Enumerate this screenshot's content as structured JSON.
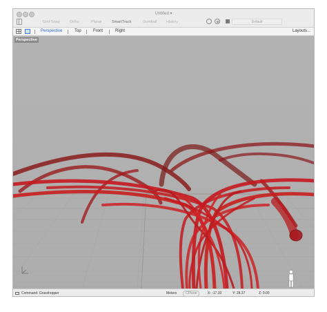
{
  "window": {
    "title": "Untitled"
  },
  "snap_bar": {
    "items": [
      {
        "label": "Grid Snap",
        "active": false
      },
      {
        "label": "Ortho",
        "active": false
      },
      {
        "label": "Planar",
        "active": false
      },
      {
        "label": "SmartTrack",
        "active": true
      },
      {
        "label": "Gumball",
        "active": false
      },
      {
        "label": "History",
        "active": false
      }
    ],
    "layer": "Default"
  },
  "viewport_tabs": [
    "Perspective",
    "Top",
    "Front",
    "Right"
  ],
  "active_tab": "Perspective",
  "layouts_label": "Layouts...",
  "viewport": {
    "label": "Perspective",
    "background": "#b3b3b3",
    "object_color": "#c41a1f"
  },
  "status": {
    "command": "Command: Grasshopper",
    "units": "Meters",
    "cplane": "CPlane",
    "x": "X: -17.33",
    "y": "Y: 28.37",
    "z": "Z: 0.00"
  },
  "icons": [
    "sidebar-toggle-icon",
    "osnap-circle-icon",
    "record-history-icon",
    "four-viewport-icon",
    "single-viewport-icon",
    "command-prompt-icon",
    "axis-gizmo-icon",
    "human-scale-icon"
  ]
}
